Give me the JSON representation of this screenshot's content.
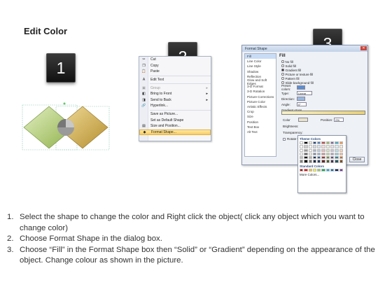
{
  "title": "Edit Color",
  "steps": [
    "1",
    "2",
    "3"
  ],
  "context_menu": {
    "items": [
      {
        "icon": "scissors-icon",
        "glyph": "✂",
        "label": "Cut",
        "u": "t",
        "dim": false
      },
      {
        "icon": "copy-icon",
        "glyph": "❐",
        "label": "Copy",
        "u": "C",
        "dim": false
      },
      {
        "icon": "paste-icon",
        "glyph": "📋",
        "label": "Paste",
        "u": "P",
        "dim": false
      },
      {
        "sep": true
      },
      {
        "icon": "edit-text-icon",
        "glyph": "A",
        "label": "Edit Text",
        "u": "",
        "dim": false
      },
      {
        "sep": true
      },
      {
        "icon": "group-icon",
        "glyph": "▣",
        "label": "Group",
        "u": "G",
        "dim": true,
        "arrow": true
      },
      {
        "icon": "bring-to-front-icon",
        "glyph": "◧",
        "label": "Bring to Front",
        "u": "F",
        "dim": false,
        "arrow": true
      },
      {
        "icon": "send-to-back-icon",
        "glyph": "◨",
        "label": "Send to Back",
        "u": "K",
        "dim": false,
        "arrow": true
      },
      {
        "icon": "hyperlink-icon",
        "glyph": "🔗",
        "label": "Hyperlink...",
        "u": "H",
        "dim": false
      },
      {
        "sep": true
      },
      {
        "icon": "save-picture-icon",
        "glyph": "",
        "label": "Save as Picture...",
        "u": "S",
        "dim": false
      },
      {
        "icon": "default-shape-icon",
        "glyph": "",
        "label": "Set as Default Shape",
        "u": "D",
        "dim": false
      },
      {
        "icon": "size-position-icon",
        "glyph": "▤",
        "label": "Size and Position...",
        "u": "z",
        "dim": false
      },
      {
        "icon": "format-shape-icon",
        "glyph": "◆",
        "label": "Format Shape...",
        "u": "o",
        "dim": false,
        "hl": true
      }
    ]
  },
  "dialog": {
    "title": "Format Shape",
    "close_glyph": "✕",
    "categories": [
      "Fill",
      "Line Color",
      "Line Style",
      "Shadow",
      "Reflection",
      "Glow and Soft Edges",
      "3-D Format",
      "3-D Rotation",
      "Picture Corrections",
      "Picture Color",
      "Artistic Effects",
      "Crop",
      "Size",
      "Position",
      "Text Box",
      "Alt Text"
    ],
    "heading": "Fill",
    "fill_options": [
      "No fill",
      "Solid fill",
      "Gradient fill",
      "Picture or texture fill",
      "Pattern fill",
      "Slide background fill"
    ],
    "selected_fill": 2,
    "preset_label": "Preset colors:",
    "type_label": "Type:",
    "type_value": "Linear",
    "direction_label": "Direction:",
    "angle_label": "Angle:",
    "angle_value": "0°",
    "stops_label": "Gradient stops",
    "color_label": "Color",
    "position_label": "Position:",
    "position_value": "0%",
    "brightness_label": "Brightness:",
    "transparency_label": "Transparency:",
    "rotate_label": "Rotate with shape",
    "theme_colors_label": "Theme Colors",
    "standard_colors_label": "Standard Colors",
    "more_colors_label": "More Colors...",
    "close_label": "Close"
  },
  "palette": {
    "theme": [
      "#ffffff",
      "#000000",
      "#eeece1",
      "#1f497d",
      "#4f81bd",
      "#c0504d",
      "#9bbb59",
      "#8064a2",
      "#4bacc6",
      "#f79646"
    ],
    "standard": [
      "#c00000",
      "#ff0000",
      "#ffc000",
      "#ffff00",
      "#92d050",
      "#00b050",
      "#00b0f0",
      "#0070c0",
      "#002060",
      "#7030a0"
    ]
  },
  "instructions": [
    {
      "num": "1.",
      "text": "Select the shape to change the color and Right click the object( click any object which you want to change color)"
    },
    {
      "num": "2.",
      "text": "Choose Format Shape in the dialog box."
    },
    {
      "num": "3.",
      "text": "Choose “Fill” in the Format Shape box then “Solid” or “Gradient” depending on the appearance of the object. Change colour as shown in the picture."
    }
  ]
}
